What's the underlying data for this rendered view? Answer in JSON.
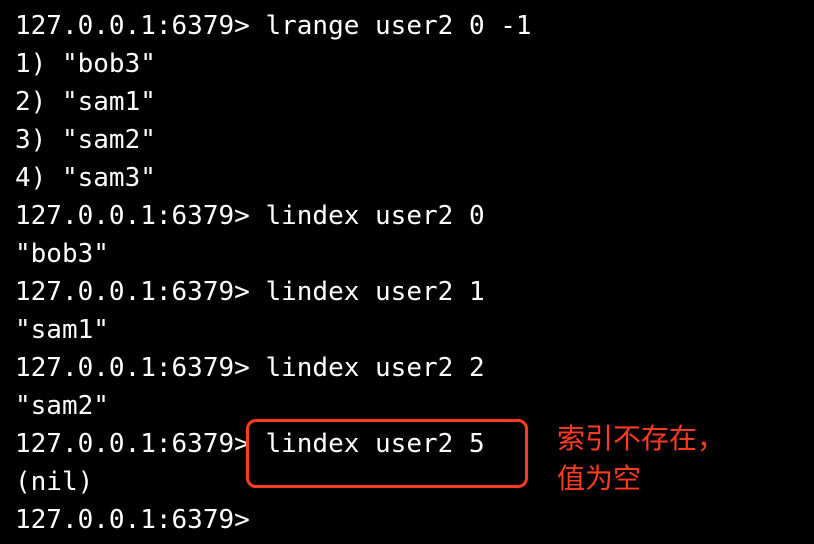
{
  "terminal": {
    "lines": [
      "127.0.0.1:6379> lrange user2 0 -1",
      "1) \"bob3\"",
      "2) \"sam1\"",
      "3) \"sam2\"",
      "4) \"sam3\"",
      "127.0.0.1:6379> lindex user2 0",
      "\"bob3\"",
      "127.0.0.1:6379> lindex user2 1",
      "\"sam1\"",
      "127.0.0.1:6379> lindex user2 2",
      "\"sam2\"",
      "127.0.0.1:6379> lindex user2 5",
      "(nil)",
      "127.0.0.1:6379>"
    ]
  },
  "annotation": {
    "line1": "索引不存在，",
    "line2": "值为空",
    "color": "#ff3b1f"
  }
}
